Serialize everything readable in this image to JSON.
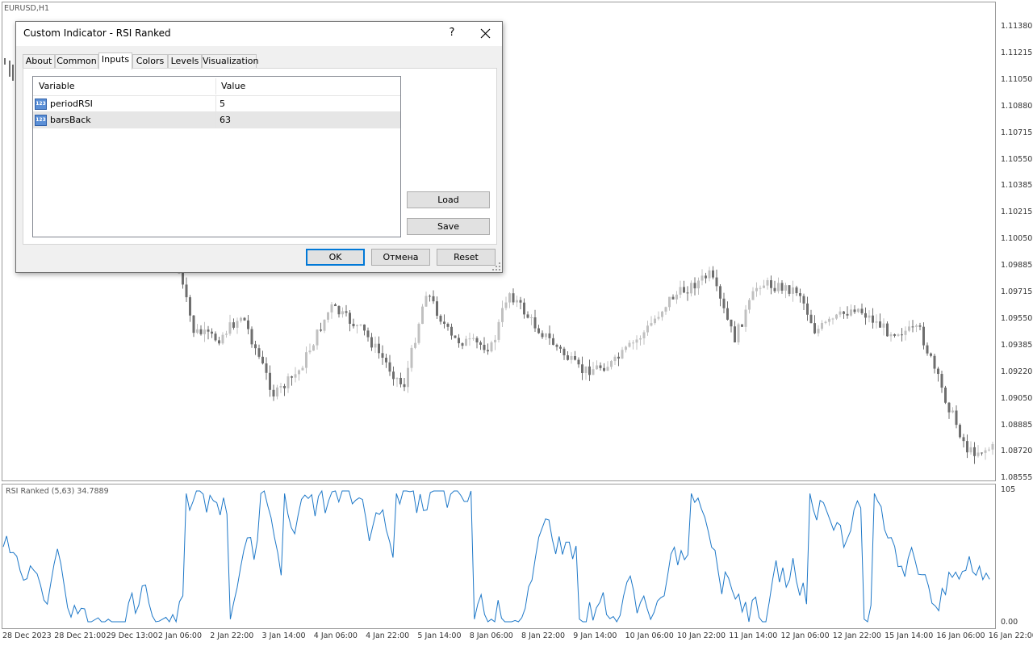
{
  "chart": {
    "symbol_label": "EURUSD,H1",
    "y_ticks": [
      "1.11380",
      "1.11215",
      "1.11050",
      "1.10880",
      "1.10715",
      "1.10550",
      "1.10385",
      "1.10215",
      "1.10050",
      "1.09885",
      "1.09715",
      "1.09550",
      "1.09385",
      "1.09220",
      "1.09050",
      "1.08885",
      "1.08720",
      "1.08555"
    ],
    "x_ticks": [
      "28 Dec 2023",
      "28 Dec 21:00",
      "29 Dec 13:00",
      "2 Jan 06:00",
      "2 Jan 22:00",
      "3 Jan 14:00",
      "4 Jan 06:00",
      "4 Jan 22:00",
      "5 Jan 14:00",
      "8 Jan 06:00",
      "8 Jan 22:00",
      "9 Jan 14:00",
      "10 Jan 06:00",
      "10 Jan 22:00",
      "11 Jan 14:00",
      "12 Jan 06:00",
      "12 Jan 22:00",
      "15 Jan 14:00",
      "16 Jan 06:00",
      "16 Jan 22:00"
    ],
    "candle_up_color": "#c0c0c0",
    "candle_down_color": "#6e6e6e"
  },
  "indicator": {
    "label": "RSI Ranked (5,63) 34.7889",
    "y_max_label": "105",
    "y_min_label": "0.00",
    "line_color": "#1e78c8"
  },
  "dialog": {
    "title": "Custom Indicator - RSI Ranked",
    "help_label": "?",
    "tabs": [
      {
        "label": "About"
      },
      {
        "label": "Common"
      },
      {
        "label": "Inputs"
      },
      {
        "label": "Colors"
      },
      {
        "label": "Levels"
      },
      {
        "label": "Visualization"
      }
    ],
    "active_tab": "Inputs",
    "grid": {
      "col_variable": "Variable",
      "col_value": "Value",
      "rows": [
        {
          "icon": "123-number-icon",
          "name": "periodRSI",
          "value": "5"
        },
        {
          "icon": "123-number-icon",
          "name": "barsBack",
          "value": "63"
        }
      ]
    },
    "load_label": "Load",
    "save_label": "Save",
    "ok_label": "OK",
    "cancel_label": "Отмена",
    "reset_label": "Reset"
  }
}
